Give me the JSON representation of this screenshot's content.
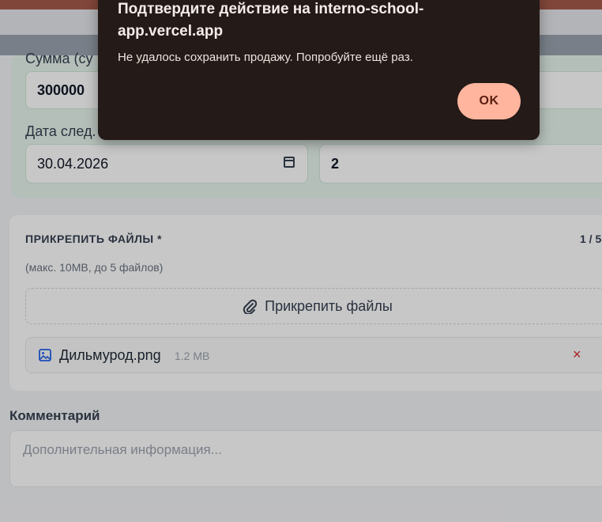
{
  "form": {
    "sum_label": "Сумма (су",
    "sum_value": "300000",
    "date_label": "Дата след.",
    "date_value": "30.04.2026",
    "count_value": "2"
  },
  "files": {
    "title": "ПРИКРЕПИТЬ ФАЙЛЫ *",
    "count": "1 / 5",
    "hint": "(макс. 10MB, до 5 файлов)",
    "attach_label": "Прикрепить файлы",
    "items": [
      {
        "name": "Дильмурод.png",
        "size": "1.2 MB",
        "remove": "×"
      }
    ]
  },
  "comment": {
    "label": "Комментарий",
    "placeholder": "Дополнительная информация..."
  },
  "dialog": {
    "title": "Подтвердите действие на interno-school-app.vercel.app",
    "message": "Не удалось сохранить продажу. Попробуйте ещё раз.",
    "ok_label": "OK"
  },
  "colors": {
    "dialog_bg": "#241a17",
    "ok_button": "#ffb59e",
    "remove_icon": "#dc2626"
  }
}
